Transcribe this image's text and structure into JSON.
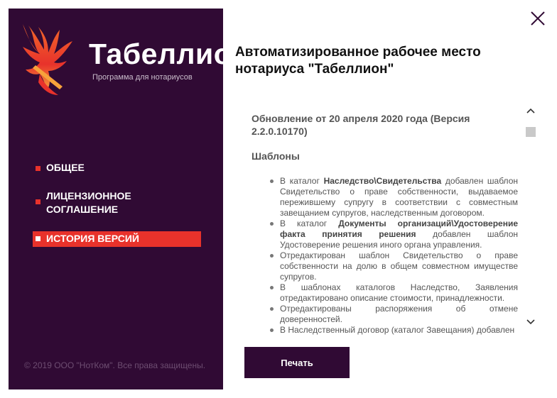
{
  "app": {
    "logo_title": "Табеллион",
    "logo_subtitle": "Программа для нотариусов",
    "logo_icon": "phoenix-logo-icon"
  },
  "sidebar": {
    "items": [
      {
        "label": "ОБЩЕЕ",
        "active": false
      },
      {
        "label": "ЛИЦЕНЗИОННОЕ СОГЛАШЕНИЕ",
        "active": false
      },
      {
        "label": "ИСТОРИЯ ВЕРСИЙ",
        "active": true
      }
    ],
    "copyright": "© 2019 ООО \"НотКом\". Все права защищены."
  },
  "header": {
    "title": "Автоматизированное рабочее место нотариуса \"Табеллион\""
  },
  "content": {
    "version_heading": "Обновление от 20 апреля 2020 года (Версия 2.2.0.10170)",
    "section_heading": "Шаблоны",
    "changes": [
      {
        "prefix": "В каталог ",
        "bold": "Наследство\\Свидетельства",
        "suffix": " добавлен шаблон Свидетельство о праве собственности, выдаваемое пережившему супругу в соответствии с совместным завещанием супругов, наследственным договором."
      },
      {
        "prefix": "В каталог ",
        "bold": "Документы организаций\\Удостоверение факта принятия решения",
        "suffix": " добавлен шаблон Удостоверение решения иного органа управления."
      },
      {
        "prefix": "",
        "bold": "",
        "suffix": "Отредактирован шаблон Свидетельство о праве собственности на долю в общем совместном имуществе супругов."
      },
      {
        "prefix": "",
        "bold": "",
        "suffix": "В шаблонах каталогов Наследство, Заявления отредактировано описание стоимости, принадлежности."
      },
      {
        "prefix": "",
        "bold": "",
        "suffix": "Отредактированы распоряжения об отмене доверенностей."
      },
      {
        "prefix": "",
        "bold": "",
        "suffix": "В Наследственный договор (каталог Завещания) добавлен"
      }
    ]
  },
  "buttons": {
    "print_label": "Печать"
  },
  "icons": {
    "close": "close-icon",
    "scroll_up": "chevron-up-icon",
    "scroll_down": "chevron-down-icon"
  },
  "colors": {
    "sidebar_bg": "#300a34",
    "accent": "#e8322b",
    "button_bg": "#300a34"
  }
}
